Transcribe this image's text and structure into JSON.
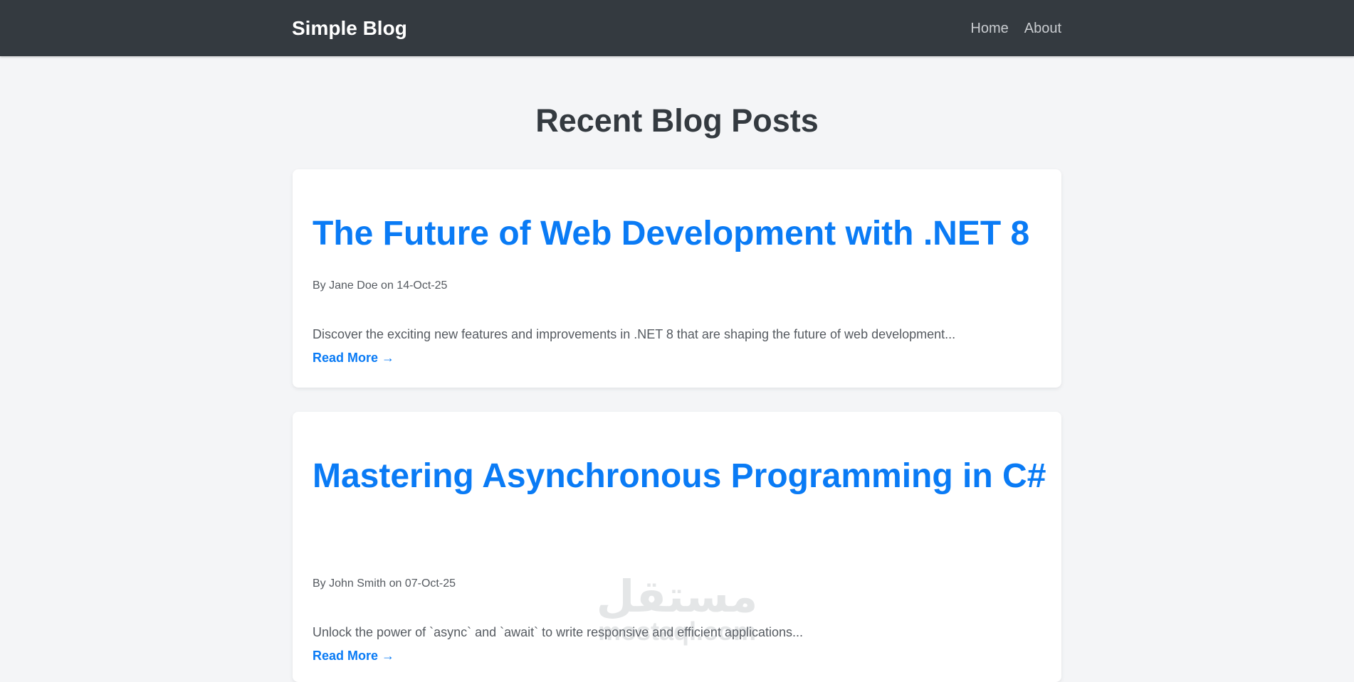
{
  "nav": {
    "brand": "Simple Blog",
    "links": [
      "Home",
      "About"
    ]
  },
  "main": {
    "title": "Recent Blog Posts",
    "posts": [
      {
        "title": "The Future of Web Development with .NET 8",
        "meta": "By Jane Doe on 14-Oct-25",
        "excerpt": "Discover the exciting new features and improvements in .NET 8 that are shaping the future of web development...",
        "read_more": "Read More →"
      },
      {
        "title": "Mastering Asynchronous Programming in C#",
        "meta": "By John Smith on 07-Oct-25",
        "excerpt": "Unlock the power of `async` and `await` to write responsive and efficient applications...",
        "read_more": "Read More →"
      }
    ]
  },
  "watermark": {
    "arabic": "مستقل",
    "latin": "mostaql.com"
  },
  "colors": {
    "navbar": "#343a40",
    "background": "#f4f5f7",
    "accent": "#0a7bf5",
    "heading": "#343a40",
    "muted_text": "#555a60"
  }
}
